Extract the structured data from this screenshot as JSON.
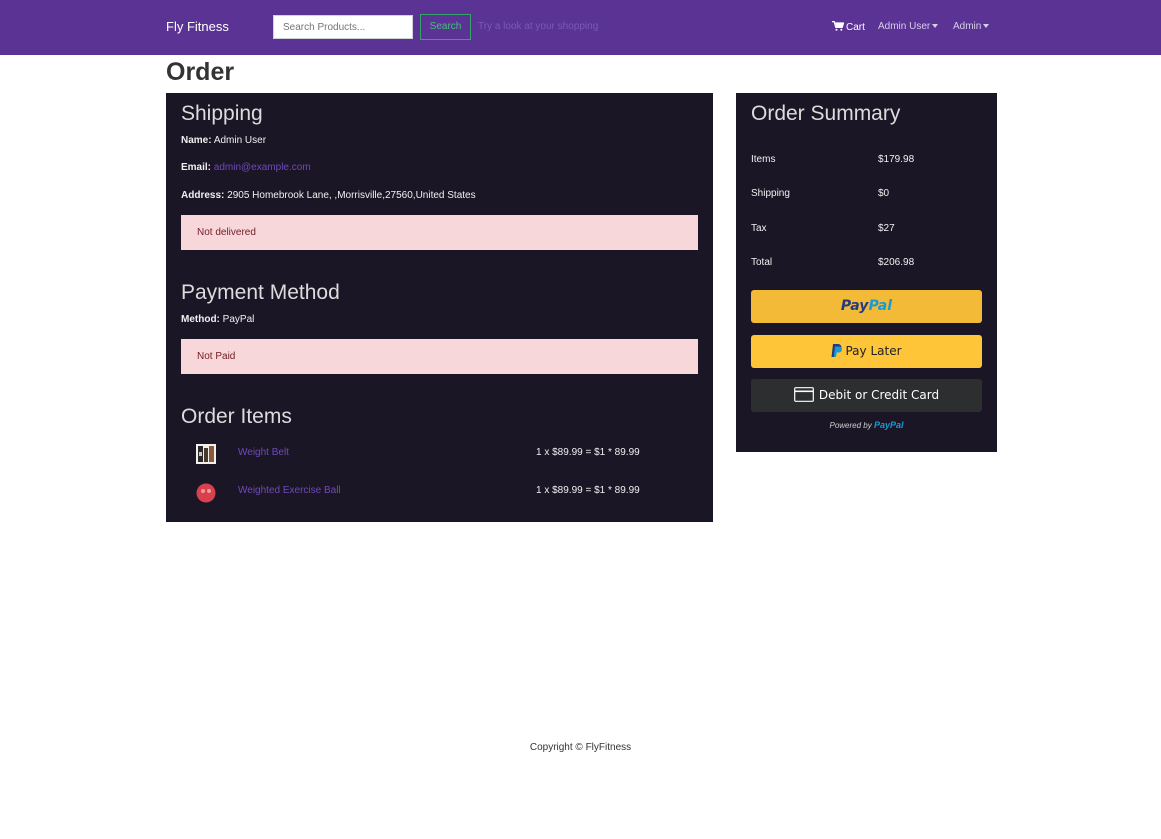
{
  "navbar": {
    "brand": "Fly Fitness",
    "search_placeholder": "Search Products...",
    "search_button": "Search",
    "search_hint": "Try a look at your shopping",
    "cart_label": "Cart",
    "user_menu": "Admin User",
    "admin_menu": "Admin"
  },
  "page": {
    "title": "Order"
  },
  "shipping": {
    "title": "Shipping",
    "name_label": "Name:",
    "name_value": "Admin User",
    "email_label": "Email:",
    "email_value": "admin@example.com",
    "address_label": "Address:",
    "address_value": "2905 Homebrook Lane, ,Morrisville,27560,United States",
    "status": "Not delivered"
  },
  "payment": {
    "title": "Payment Method",
    "method_label": "Method:",
    "method_value": "PayPal",
    "status": "Not Paid"
  },
  "order_items": {
    "title": "Order Items",
    "items": [
      {
        "name": "Weight Belt",
        "price_line": "1 x $89.99 = $1 * 89.99"
      },
      {
        "name": "Weighted Exercise Ball",
        "price_line": "1 x $89.99 = $1 * 89.99"
      }
    ]
  },
  "summary": {
    "title": "Order Summary",
    "rows": [
      {
        "label": "Items",
        "value": "$179.98"
      },
      {
        "label": "Shipping",
        "value": "$0"
      },
      {
        "label": "Tax",
        "value": "$27"
      },
      {
        "label": "Total",
        "value": "$206.98"
      }
    ],
    "paypal_button_part1": "Pay",
    "paypal_button_part2": "Pal",
    "pay_later_label": "Pay Later",
    "card_label": "Debit or Credit Card",
    "powered_by": "Powered by",
    "powered_brand": "PayPal"
  },
  "footer": {
    "copyright": "Copyright © FlyFitness"
  },
  "colors": {
    "navbar": "#5b3395",
    "panel": "#1b1626",
    "alert_bg": "#f8d7da",
    "link": "#6f49b8",
    "paypal_gold": "#f2ba36"
  }
}
